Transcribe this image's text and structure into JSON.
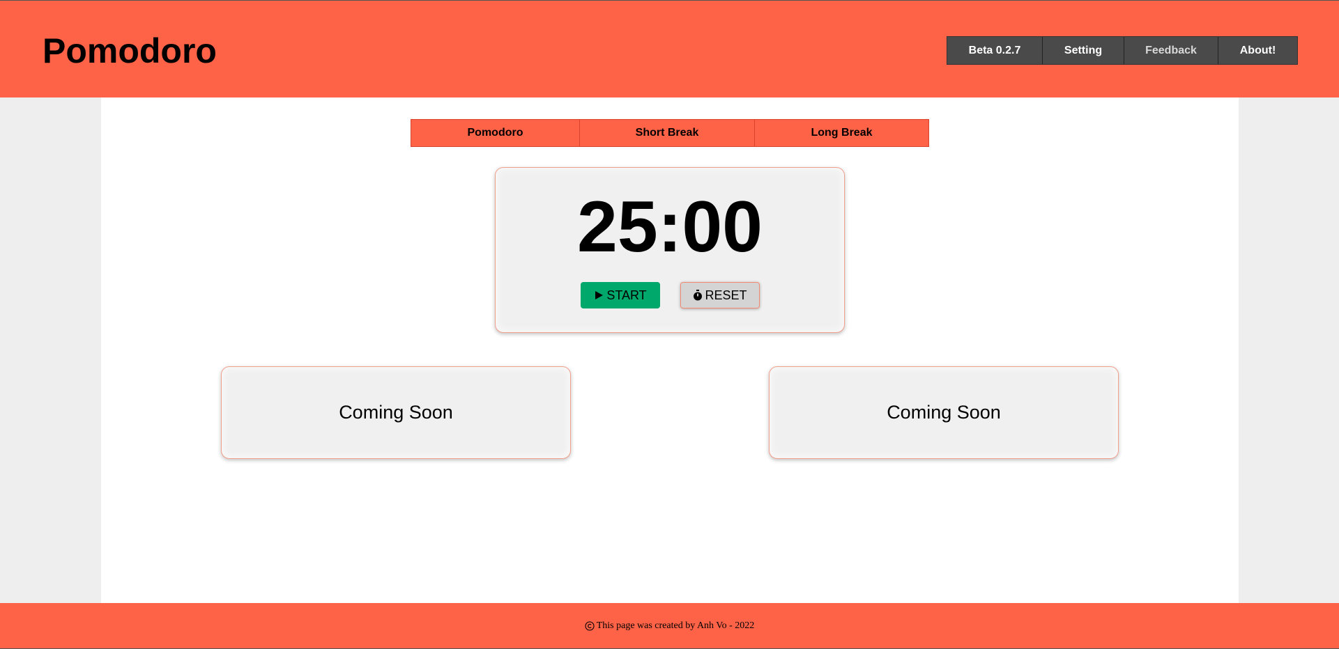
{
  "header": {
    "title": "Pomodoro",
    "nav": [
      {
        "label": "Beta 0.2.7"
      },
      {
        "label": "Setting"
      },
      {
        "label": "Feedback"
      },
      {
        "label": "About!"
      }
    ]
  },
  "modes": [
    {
      "label": "Pomodoro"
    },
    {
      "label": "Short Break"
    },
    {
      "label": "Long Break"
    }
  ],
  "timer": {
    "display": "25:00",
    "start_label": "START",
    "start_icon": "play-icon",
    "reset_label": "RESET",
    "reset_icon": "stopwatch-icon"
  },
  "panels": [
    {
      "label": "Coming Soon"
    },
    {
      "label": "Coming Soon"
    }
  ],
  "footer": {
    "icon": "copyright-icon",
    "text": "This page was created by Anh Vo - 2022"
  },
  "colors": {
    "accent": "#ff6347",
    "nav_bg": "#4a4a4a",
    "start_green": "#00a86b"
  }
}
